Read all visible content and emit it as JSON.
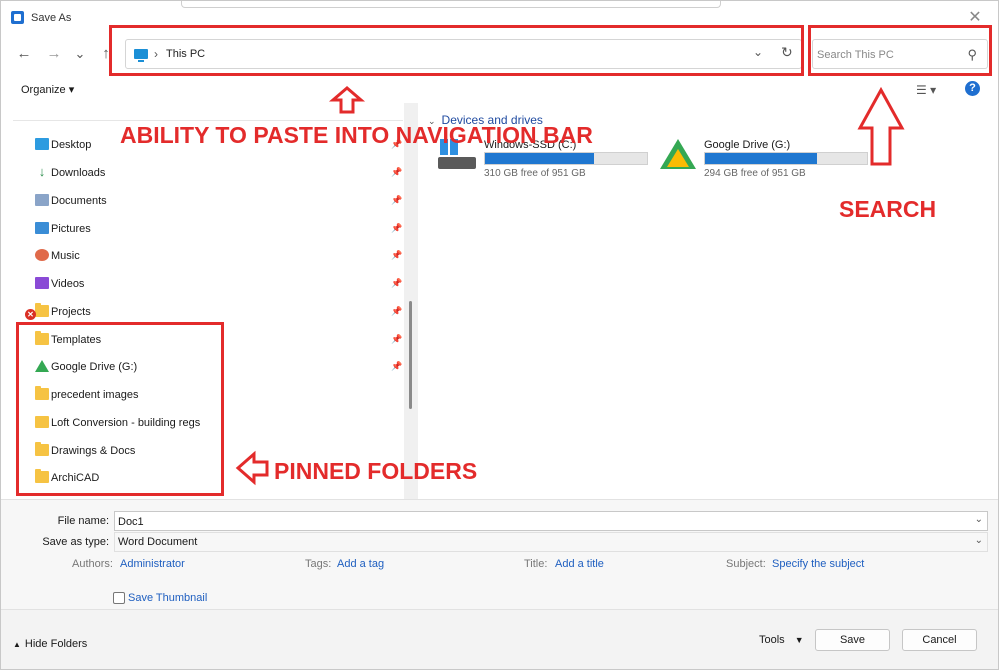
{
  "window": {
    "title": "Save As",
    "close_glyph": "✕"
  },
  "nav": {
    "back_glyph": "←",
    "forward_glyph": "→",
    "recent_glyph": "⌄",
    "up_glyph": "↑",
    "address_separator": "›",
    "address_text": "This PC",
    "address_dropdown_glyph": "⌄",
    "refresh_glyph": "↻",
    "search_placeholder": "Search This PC",
    "search_glyph": "⚲"
  },
  "command_bar": {
    "organize_label": "Organize ▾",
    "view_glyph": "☰ ▾",
    "help_glyph": "?"
  },
  "sidebar": {
    "items": [
      {
        "label": "Desktop",
        "icon": "desktop-icon",
        "pinned": true
      },
      {
        "label": "Downloads",
        "icon": "download-icon",
        "pinned": true
      },
      {
        "label": "Documents",
        "icon": "documents-icon",
        "pinned": true
      },
      {
        "label": "Pictures",
        "icon": "pictures-icon",
        "pinned": true
      },
      {
        "label": "Music",
        "icon": "music-icon",
        "pinned": true
      },
      {
        "label": "Videos",
        "icon": "videos-icon",
        "pinned": true
      },
      {
        "label": "Projects",
        "icon": "folder-icon",
        "pinned": true
      },
      {
        "label": "Templates",
        "icon": "folder-icon",
        "pinned": true
      },
      {
        "label": "Google Drive (G:)",
        "icon": "google-drive-icon",
        "pinned": true
      },
      {
        "label": "precedent images",
        "icon": "folder-icon",
        "pinned": false
      },
      {
        "label": "Loft Conversion - building regs",
        "icon": "cloud-folder-icon",
        "pinned": false
      },
      {
        "label": "Drawings & Docs",
        "icon": "folder-icon",
        "pinned": false
      },
      {
        "label": "ArchiCAD",
        "icon": "folder-icon",
        "pinned": false
      }
    ],
    "pin_glyph": "📌",
    "error_glyph": "✕"
  },
  "content": {
    "group_header": "Devices and drives",
    "group_chevron": "⌄",
    "drives": [
      {
        "name": "Windows-SSD (C:)",
        "free_text": "310 GB free of 951 GB",
        "used_fraction": 0.674
      },
      {
        "name": "Google Drive (G:)",
        "free_text": "294 GB free of 951 GB",
        "used_fraction": 0.691
      }
    ]
  },
  "form": {
    "file_name_label": "File name:",
    "file_name_value": "Doc1",
    "save_type_label": "Save as type:",
    "save_type_value": "Word Document",
    "dropdown_glyph": "⌄",
    "authors_label": "Authors:",
    "authors_value": "Administrator",
    "tags_label": "Tags:",
    "tags_value": "Add a tag",
    "title_label": "Title:",
    "title_value": "Add a title",
    "subject_label": "Subject:",
    "subject_value": "Specify the subject",
    "thumbnail_label": "Save Thumbnail"
  },
  "footer": {
    "hide_folders_label": "Hide Folders",
    "hide_folders_caret": "▲",
    "tools_label": "Tools",
    "tools_caret": "▼",
    "save_label": "Save",
    "cancel_label": "Cancel"
  },
  "annotations": {
    "navigation_bar": "ABILITY TO PASTE INTO NAVIGATION BAR",
    "search": "SEARCH",
    "pinned_folders": "PINNED FOLDERS",
    "color": "#e32b2b"
  }
}
